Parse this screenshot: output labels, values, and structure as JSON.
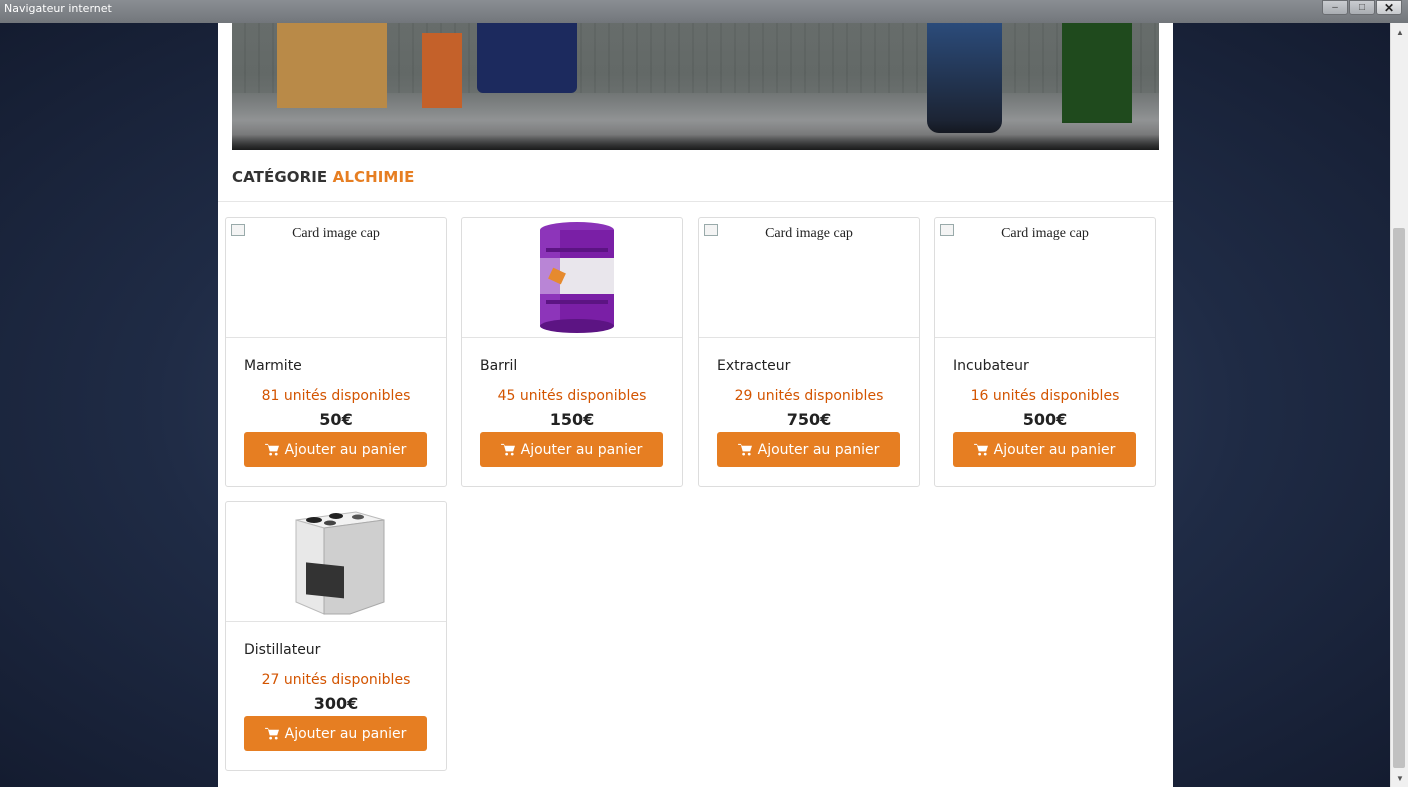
{
  "window": {
    "title": "Navigateur internet",
    "minimize": "–",
    "maximize": "□",
    "close": "✕"
  },
  "category": {
    "label": "CATÉGORIE",
    "name": "ALCHIMIE"
  },
  "accent_color": "#e67e22",
  "stock_color": "#d35400",
  "cart_icon": "cart-icon",
  "products": [
    {
      "name": "Marmite",
      "stock": "81 unités disponibles",
      "price": "50€",
      "image_alt": "Card image cap",
      "button": "Ajouter au panier"
    },
    {
      "name": "Barril",
      "stock": "45 unités disponibles",
      "price": "150€",
      "image_alt": "",
      "button": "Ajouter au panier"
    },
    {
      "name": "Extracteur",
      "stock": "29 unités disponibles",
      "price": "750€",
      "image_alt": "Card image cap",
      "button": "Ajouter au panier"
    },
    {
      "name": "Incubateur",
      "stock": "16 unités disponibles",
      "price": "500€",
      "image_alt": "Card image cap",
      "button": "Ajouter au panier"
    },
    {
      "name": "Distillateur",
      "stock": "27 unités disponibles",
      "price": "300€",
      "image_alt": "",
      "button": "Ajouter au panier"
    }
  ]
}
